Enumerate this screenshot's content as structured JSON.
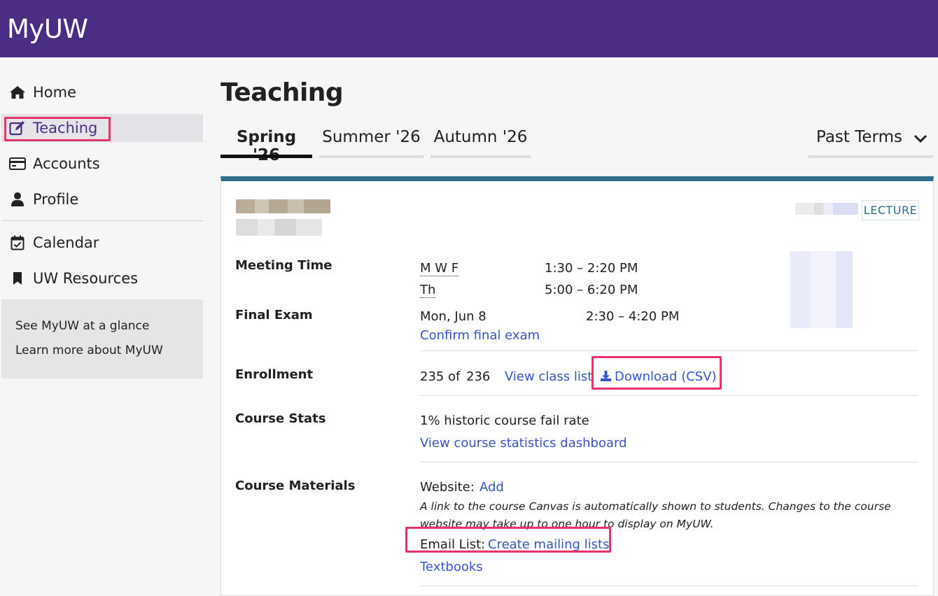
{
  "header": {
    "brand": "MyUW"
  },
  "sidebar": {
    "items": [
      {
        "label": "Home",
        "icon": "home-icon"
      },
      {
        "label": "Teaching",
        "icon": "edit-icon",
        "active": true
      },
      {
        "label": "Accounts",
        "icon": "credit-card-icon"
      },
      {
        "label": "Profile",
        "icon": "user-icon"
      },
      {
        "label": "Calendar",
        "icon": "calendar-check-icon"
      },
      {
        "label": "UW Resources",
        "icon": "bookmark-icon"
      }
    ],
    "glance_links": [
      "See MyUW at a glance",
      "Learn more about MyUW"
    ]
  },
  "main": {
    "title": "Teaching",
    "tabs": [
      {
        "label": "Spring '26",
        "active": true
      },
      {
        "label": "Summer '26"
      },
      {
        "label": "Autumn '26"
      }
    ],
    "past_terms": "Past Terms"
  },
  "course": {
    "section_type": "LECTURE",
    "meeting_time": {
      "label": "Meeting Time",
      "rows": [
        {
          "days": "M W F",
          "time": "1:30 – 2:20 PM"
        },
        {
          "days": "Th",
          "time": "5:00 – 6:20 PM"
        }
      ]
    },
    "final_exam": {
      "label": "Final Exam",
      "date": "Mon, Jun 8",
      "time": "2:30 – 4:20 PM",
      "confirm": "Confirm final exam"
    },
    "enrollment": {
      "label": "Enrollment",
      "current": "235",
      "of": "of",
      "limit": "236",
      "view_list": "View class list",
      "download": "Download (CSV)"
    },
    "course_stats": {
      "label": "Course Stats",
      "fail_rate": "1% historic course fail rate",
      "dashboard": "View course statistics dashboard"
    },
    "course_materials": {
      "label": "Course Materials",
      "website_label": "Website:",
      "website_add": "Add",
      "note": "A link to the course Canvas is automatically shown to students. Changes to the course website may take up to one hour to display on MyUW.",
      "email_label": "Email List:",
      "email_link": "Create mailing lists",
      "textbooks": "Textbooks"
    }
  },
  "colors": {
    "header": "#4b2e83",
    "accent_bar": "#2f6e8a",
    "link": "#3a55c8",
    "highlight": "#e8336d"
  }
}
